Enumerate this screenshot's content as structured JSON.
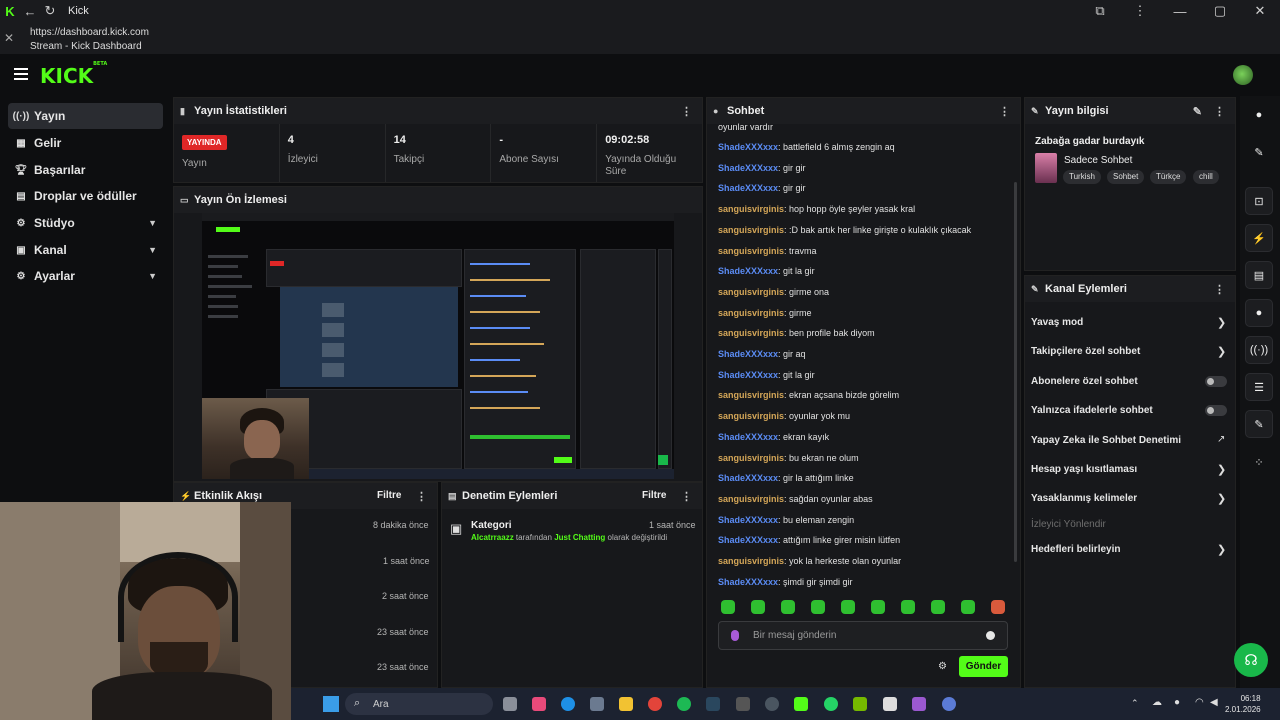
{
  "window": {
    "title": "Kick",
    "url": "https://dashboard.kick.com",
    "page_title": "Stream - Kick Dashboard"
  },
  "logo": "KICK",
  "logo_beta": "BETA",
  "sidebar": {
    "items": [
      {
        "label": "Yayın",
        "icon": "stream-icon"
      },
      {
        "label": "Gelir",
        "icon": "revenue-icon"
      },
      {
        "label": "Başarılar",
        "icon": "trophy-icon"
      },
      {
        "label": "Droplar ve ödüller",
        "icon": "gift-icon"
      },
      {
        "label": "Stüdyo",
        "icon": "studio-icon"
      },
      {
        "label": "Kanal",
        "icon": "channel-icon"
      },
      {
        "label": "Ayarlar",
        "icon": "gear-icon"
      }
    ]
  },
  "stats_panel": {
    "title": "Yayın İstatistikleri",
    "live_badge": "YAYINDA",
    "live_label": "Yayın",
    "viewers_value": "4",
    "viewers_label": "İzleyici",
    "followers_value": "14",
    "followers_label": "Takipçi",
    "subs_value": "-",
    "subs_label": "Abone Sayısı",
    "duration_value": "09:02:58",
    "duration_label": "Yayında Olduğu Süre"
  },
  "preview_panel": {
    "title": "Yayın Ön İzlemesi"
  },
  "activity_panel": {
    "title": "Etkinlik Akışı",
    "filter": "Filtre",
    "rows": [
      "8 dakika önce",
      "1 saat önce",
      "2 saat önce",
      "23 saat önce",
      "23 saat önce"
    ]
  },
  "moderation_panel": {
    "title": "Denetim Eylemleri",
    "filter": "Filtre",
    "item_title": "Kategori",
    "item_time": "1 saat önce",
    "item_user": "Alcatrraazz",
    "item_mid": "tarafından",
    "item_category": "Just Chatting",
    "item_end": "olarak değiştirildi"
  },
  "chat": {
    "title": "Sohbet",
    "top_partial": "oyunlar vardır",
    "messages": [
      {
        "user": "ShadeXXXxxx",
        "color": "blue",
        "text": ": battlefield 6 almış zengin aq"
      },
      {
        "user": "ShadeXXXxxx",
        "color": "blue",
        "text": ": gir gir"
      },
      {
        "user": "ShadeXXXxxx",
        "color": "blue",
        "text": ": gir gir"
      },
      {
        "user": "sanguisvirginis",
        "color": "gold",
        "text": ": hop hopp öyle şeyler yasak kral"
      },
      {
        "user": "sanguisvirginis",
        "color": "gold",
        "text": ": :D bak artık her linke girişte o kulaklık çıkacak"
      },
      {
        "user": "sanguisvirginis",
        "color": "gold",
        "text": ": travma"
      },
      {
        "user": "ShadeXXXxxx",
        "color": "blue",
        "text": ": git la gir"
      },
      {
        "user": "sanguisvirginis",
        "color": "gold",
        "text": ": girme ona"
      },
      {
        "user": "sanguisvirginis",
        "color": "gold",
        "text": ": girme"
      },
      {
        "user": "sanguisvirginis",
        "color": "gold",
        "text": ": ben profile bak diyom"
      },
      {
        "user": "ShadeXXXxxx",
        "color": "blue",
        "text": ": gir aq"
      },
      {
        "user": "ShadeXXXxxx",
        "color": "blue",
        "text": ": git la gir"
      },
      {
        "user": "sanguisvirginis",
        "color": "gold",
        "text": ": ekran açsana bizde görelim"
      },
      {
        "user": "sanguisvirginis",
        "color": "gold",
        "text": ": oyunlar yok mu"
      },
      {
        "user": "ShadeXXXxxx",
        "color": "blue",
        "text": ": ekran kayık"
      },
      {
        "user": "sanguisvirginis",
        "color": "gold",
        "text": ": bu ekran ne olum"
      },
      {
        "user": "ShadeXXXxxx",
        "color": "blue",
        "text": ": gir la attığım linke"
      },
      {
        "user": "sanguisvirginis",
        "color": "gold",
        "text": ": sağdan oyunlar abas"
      },
      {
        "user": "ShadeXXXxxx",
        "color": "blue",
        "text": ": bu eleman zengin"
      },
      {
        "user": "ShadeXXXxxx",
        "color": "blue",
        "text": ": attığım linke girer misin lütfen"
      },
      {
        "user": "sanguisvirginis",
        "color": "gold",
        "text": ": yok la herkeste olan oyunlar"
      },
      {
        "user": "ShadeXXXxxx",
        "color": "blue",
        "text": ": şimdi gir şimdi gir"
      }
    ],
    "input_placeholder": "Bir mesaj gönderin",
    "send_label": "Gönder"
  },
  "stream_info": {
    "title": "Yayın bilgisi",
    "stream_title": "Zabağa gadar burdayık",
    "category": "Sadece Sohbet",
    "tags": [
      "Turkish",
      "Sohbet",
      "Türkçe",
      "chill"
    ]
  },
  "channel_actions": {
    "title": "Kanal Eylemleri",
    "items": [
      {
        "label": "Yavaş mod",
        "control": "chevron"
      },
      {
        "label": "Takipçilere özel sohbet",
        "control": "chevron"
      },
      {
        "label": "Abonelere özel sohbet",
        "control": "toggle"
      },
      {
        "label": "Yalnızca ifadelerle sohbet",
        "control": "toggle"
      },
      {
        "label": "Yapay Zeka ile Sohbet Denetimi",
        "control": "external"
      },
      {
        "label": "Hesap yaşı kısıtlaması",
        "control": "chevron"
      },
      {
        "label": "Yasaklanmış kelimeler",
        "control": "chevron"
      },
      {
        "label": "İzleyici Yönlendir",
        "control": "none"
      },
      {
        "label": "Hedefleri belirleyin",
        "control": "chevron"
      }
    ]
  },
  "taskbar": {
    "search": "Ara",
    "time": "06:18",
    "date": "2.01.2026"
  },
  "colors": {
    "accent": "#53fc18",
    "live": "#e02727",
    "user_blue": "#5b8cf5",
    "user_gold": "#d4a658",
    "bg": "#0d0e10",
    "panel": "#17181b"
  }
}
